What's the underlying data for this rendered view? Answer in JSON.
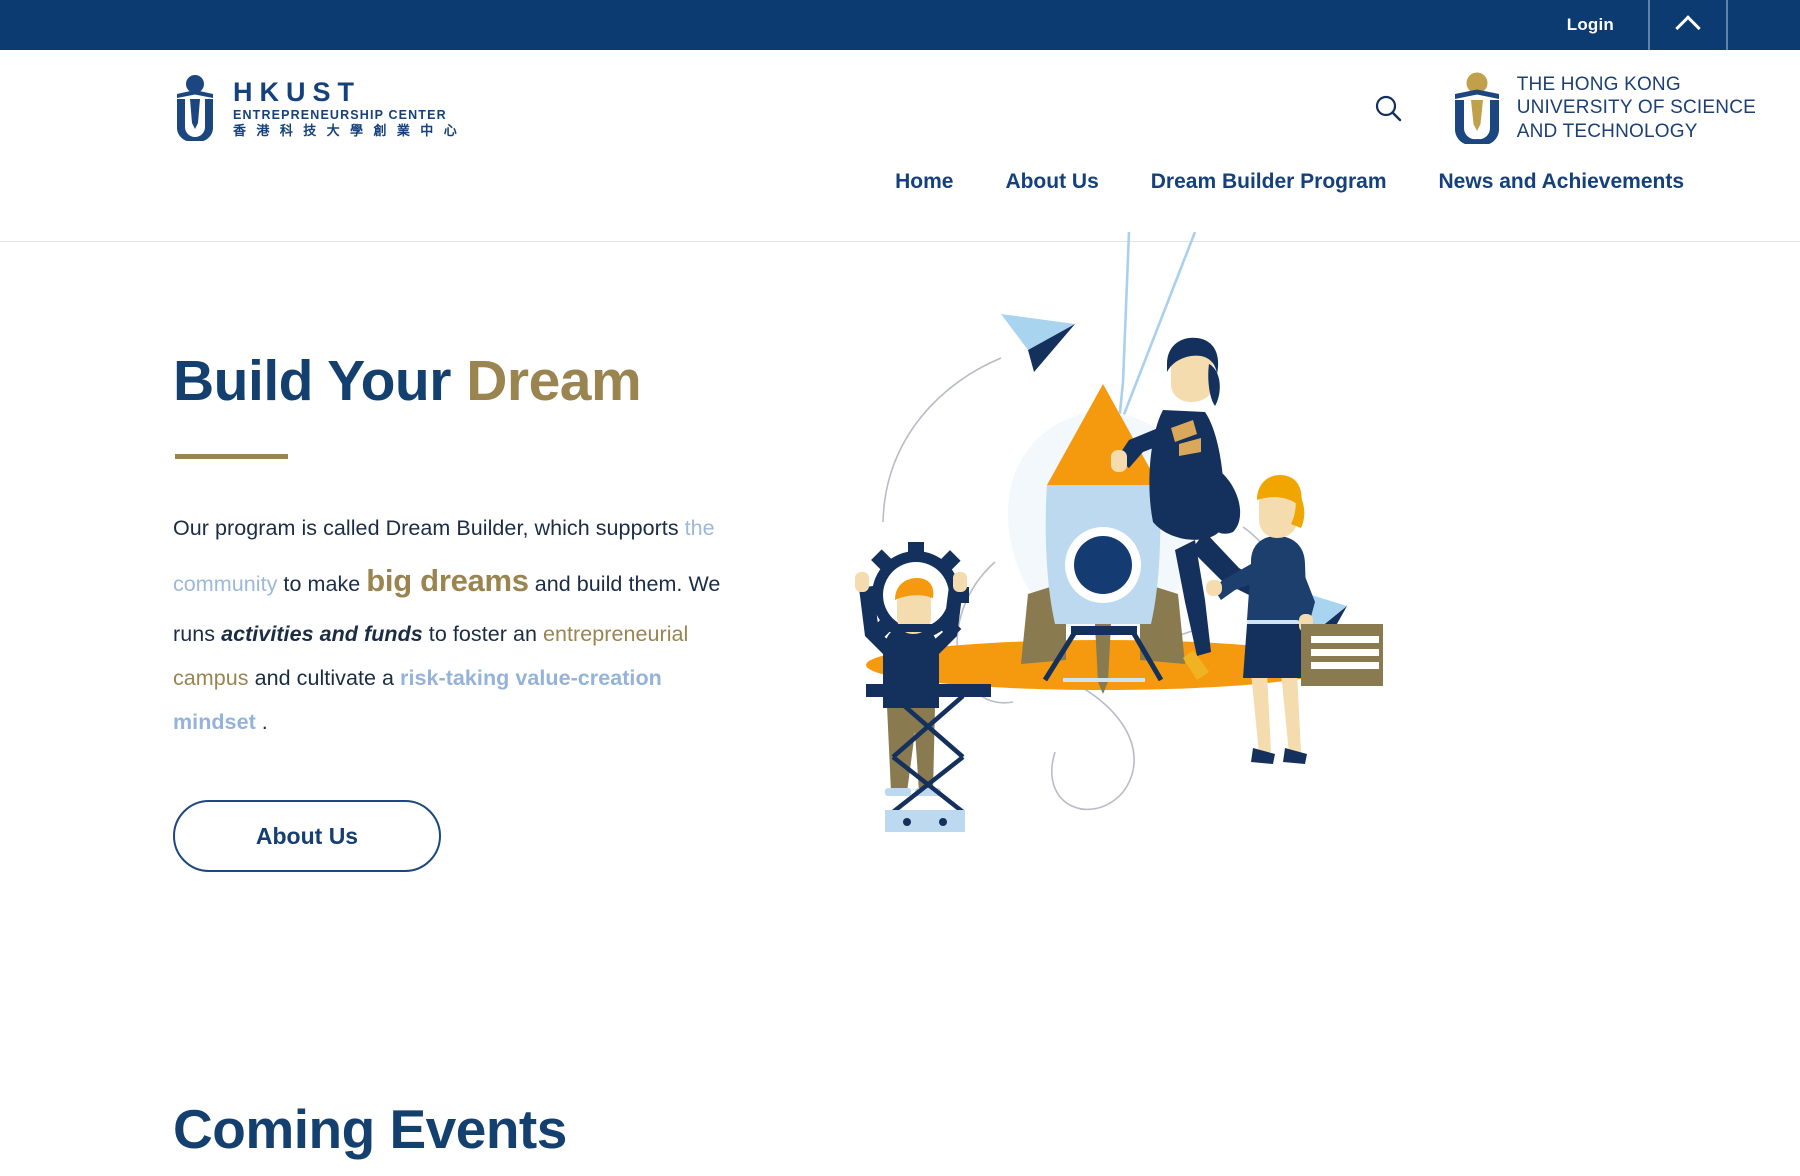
{
  "topbar": {
    "login_label": "Login",
    "toggle_icon": "chevron-up-icon"
  },
  "header": {
    "ec_logo": {
      "title": "HKUST",
      "subtitle": "ENTREPRENEURSHIP CENTER",
      "chinese": "香 港 科 技 大 學 創 業 中 心"
    },
    "search_icon": "search-icon",
    "ust_logo": {
      "line1": "THE HONG KONG",
      "line2": "UNIVERSITY OF SCIENCE",
      "line3": "AND TECHNOLOGY"
    },
    "nav": [
      {
        "label": "Home"
      },
      {
        "label": "About Us"
      },
      {
        "label": "Dream Builder Program"
      },
      {
        "label": "News and Achievements"
      }
    ]
  },
  "hero": {
    "title_part1": "Build Your ",
    "title_part2": "Dream",
    "paragraph": {
      "p1": "Our program is called Dream Builder, which supports ",
      "p2_steel": "the community",
      "p3": " to make ",
      "p4_big_gold": "big dreams",
      "p5": " and build them. We runs ",
      "p6_bold_italic": "activities and funds",
      "p7": " to foster an ",
      "p8_gold": "entrepreneurial campus",
      "p9": " and cultivate a ",
      "p10_steel_bold": "risk-taking value-creation mindset",
      "p11": " ."
    },
    "cta_label": "About Us",
    "illustration": "rocket-launch-illustration"
  },
  "events": {
    "title": "Coming Events"
  },
  "colors": {
    "navy_bar": "#0b3b70",
    "navy_text": "#13406f",
    "gold": "#9a8450",
    "steel_blue": "#93b3da",
    "orange": "#f59a0e",
    "light_blue": "#bcd9ef",
    "dark_navy": "#14305c"
  }
}
